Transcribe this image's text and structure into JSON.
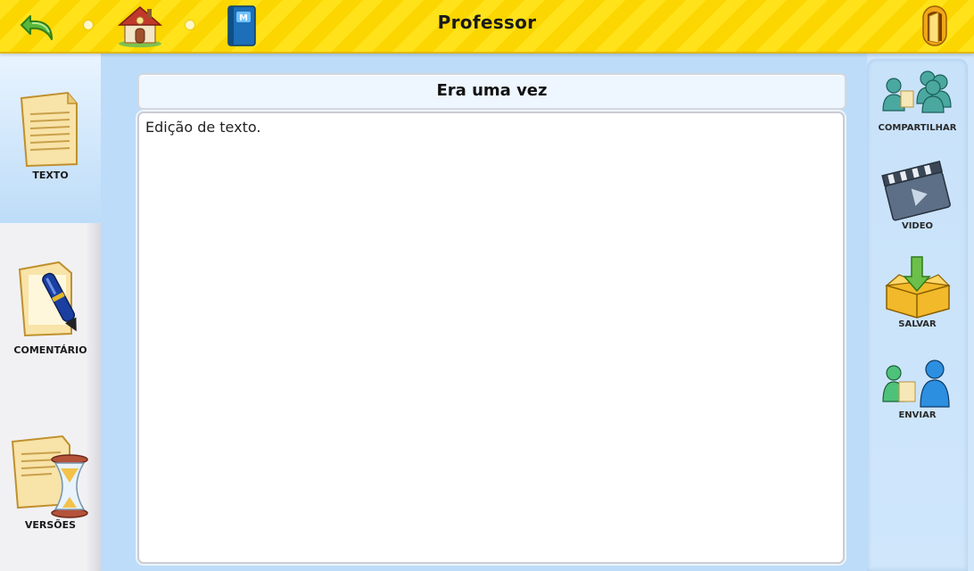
{
  "header": {
    "title": "Professor",
    "icons": [
      "back-arrow-icon",
      "home-icon",
      "notebook-icon",
      "exit-door-icon"
    ]
  },
  "left_tabs": [
    {
      "label": "TEXTO",
      "icon": "text-document-icon",
      "active": true
    },
    {
      "label": "COMENTÁRIO",
      "icon": "pen-comment-icon",
      "active": false
    },
    {
      "label": "VERSÕES",
      "icon": "hourglass-versions-icon",
      "active": false
    }
  ],
  "document": {
    "title": "Era uma vez",
    "body": "Edição de texto."
  },
  "right_actions": [
    {
      "label": "COMPARTILHAR",
      "icon": "share-people-icon"
    },
    {
      "label": "VIDEO",
      "icon": "clapperboard-icon"
    },
    {
      "label": "SALVAR",
      "icon": "save-box-icon"
    },
    {
      "label": "ENVIAR",
      "icon": "send-users-icon"
    }
  ],
  "colors": {
    "topbar_yellow": "#ffe21a",
    "panel_blue": "#bcdcf9",
    "active_tab": "#bddcf8"
  }
}
